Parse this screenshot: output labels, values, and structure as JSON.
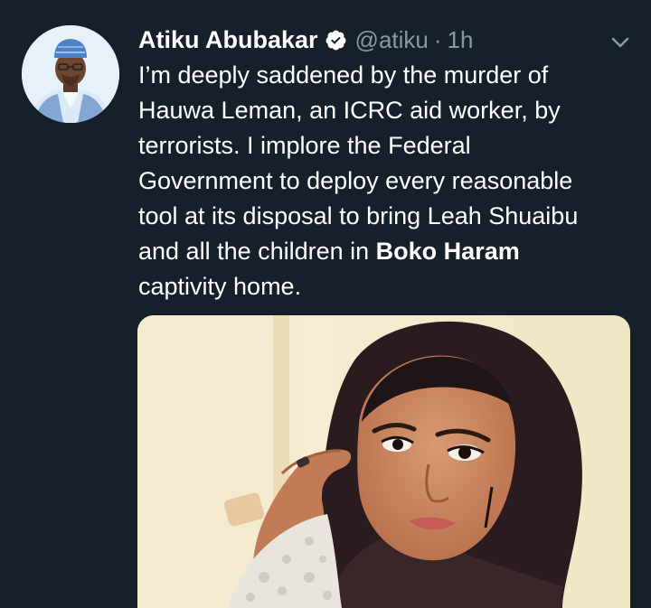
{
  "tweet": {
    "author": {
      "display_name": "Atiku Abubakar",
      "handle": "@atiku",
      "verified": true,
      "avatar_icon": "profile-photo"
    },
    "separator": "·",
    "timestamp": "1h",
    "menu_icon": "chevron-down-icon",
    "text_lines": [
      "I’m deeply saddened by the murder of",
      "Hauwa Leman, an ICRC aid worker, by",
      "terrorists. I implore the Federal",
      "Government to deploy every reasonable",
      "tool at its disposal to bring Leah Shuaibu"
    ],
    "line6_before": "and all the children in ",
    "line6_bold": "Boko Haram",
    "line7": "captivity home.",
    "media": {
      "type": "photo",
      "description_icon": "attached-photo"
    }
  },
  "colors": {
    "background": "#15202b",
    "text_primary": "#ffffff",
    "text_secondary": "#8899a6",
    "verified_badge": "#ffffff"
  }
}
